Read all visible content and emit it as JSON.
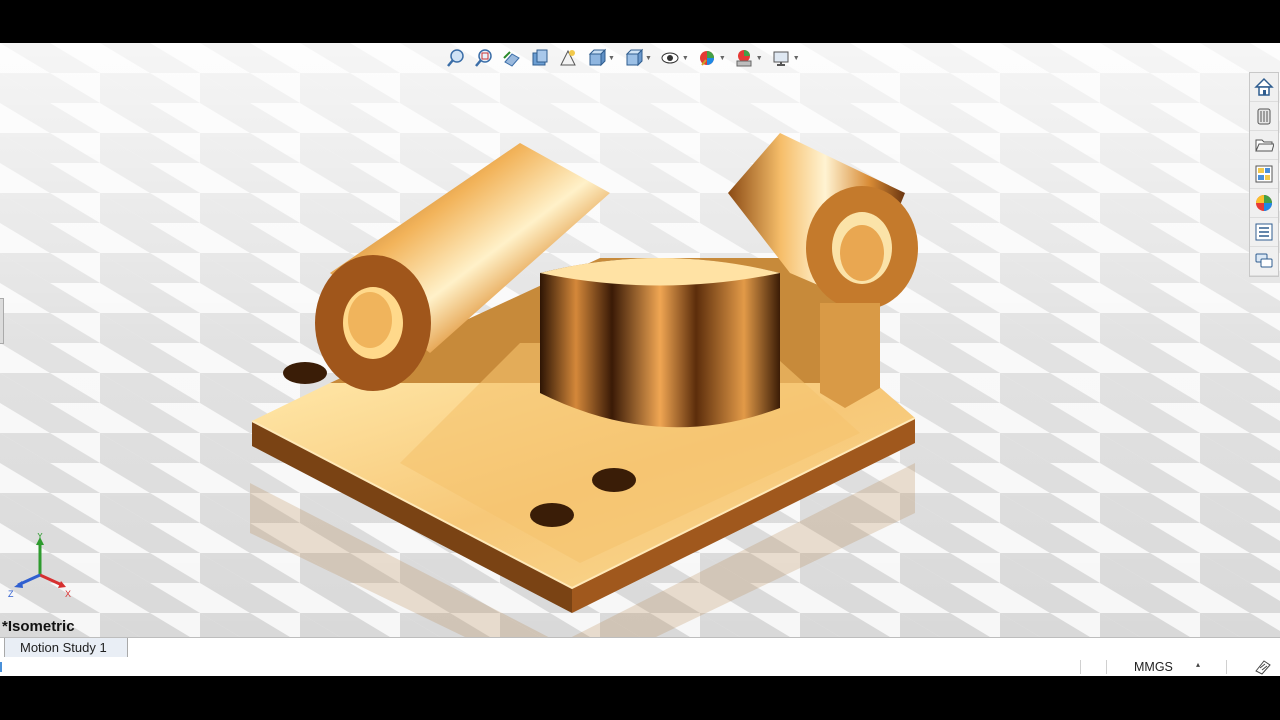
{
  "viewport": {
    "view_name": "*Isometric",
    "triad": {
      "y": "Y",
      "x": "X",
      "z": "Z"
    }
  },
  "heads_up_toolbar": {
    "items": [
      "zoom-to-fit-icon",
      "zoom-to-area-icon",
      "previous-view-icon",
      "section-view-icon",
      "dynamic-annotation-icon",
      "view-orientation-icon",
      "display-style-icon",
      "hide-show-items-icon",
      "edit-appearance-icon",
      "apply-scene-icon",
      "view-settings-icon"
    ]
  },
  "task_pane": {
    "items": [
      "home-icon",
      "design-library-icon",
      "file-explorer-icon",
      "view-palette-icon",
      "appearances-icon",
      "custom-properties-icon",
      "forum-icon"
    ]
  },
  "bottom_tabs": {
    "motion_study": "Motion Study 1"
  },
  "status_bar": {
    "units": "MMGS",
    "units_caret": "▴"
  },
  "colors": {
    "copper_light": "#f7c878",
    "copper_mid": "#c98a3c",
    "copper_dark": "#6a3a0e",
    "floor_light": "#ffffff",
    "floor_dark": "#dedede"
  }
}
